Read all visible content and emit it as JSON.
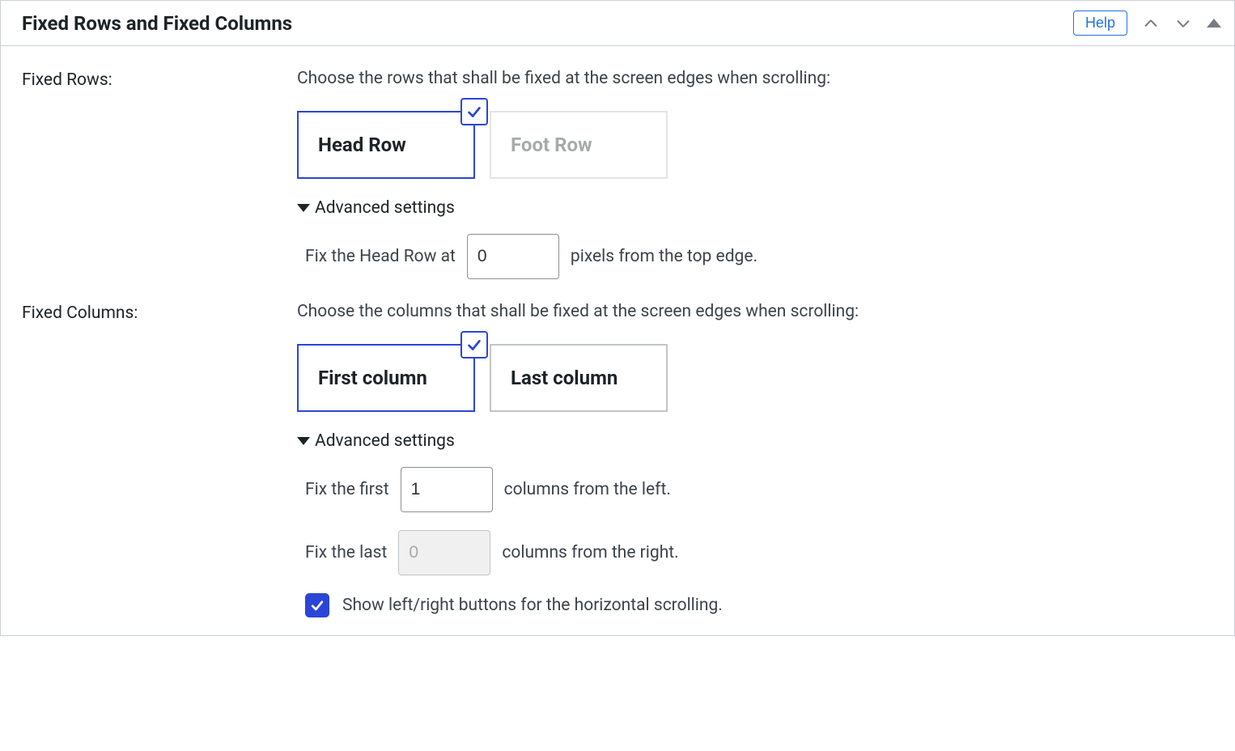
{
  "header": {
    "title": "Fixed Rows and Fixed Columns",
    "help": "Help"
  },
  "fixedRows": {
    "label": "Fixed Rows:",
    "desc": "Choose the rows that shall be fixed at the screen edges when scrolling:",
    "options": {
      "head": "Head Row",
      "foot": "Foot Row"
    },
    "advancedLabel": "Advanced settings",
    "advanced": {
      "prefix": "Fix the Head Row at",
      "value": "0",
      "suffix": "pixels from the top edge."
    }
  },
  "fixedColumns": {
    "label": "Fixed Columns:",
    "desc": "Choose the columns that shall be fixed at the screen edges when scrolling:",
    "options": {
      "first": "First column",
      "last": "Last column"
    },
    "advancedLabel": "Advanced settings",
    "advanced": {
      "firstPrefix": "Fix the first",
      "firstValue": "1",
      "firstSuffix": "columns from the left.",
      "lastPrefix": "Fix the last",
      "lastValue": "0",
      "lastSuffix": "columns from the right.",
      "showButtons": "Show left/right buttons for the horizontal scrolling."
    }
  }
}
